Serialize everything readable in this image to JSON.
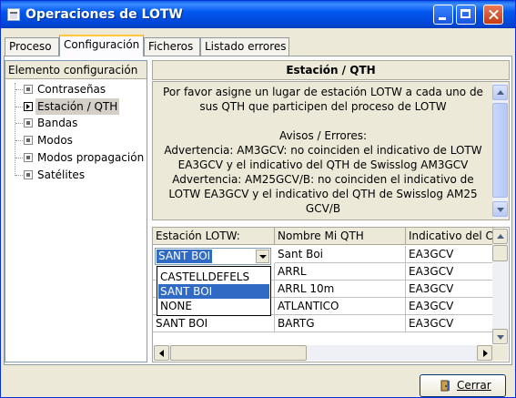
{
  "window": {
    "title": "Operaciones de LOTW"
  },
  "tabs": [
    "Proceso",
    "Configuración",
    "Ficheros",
    "Listado errores"
  ],
  "tree": {
    "header": "Elemento configuración",
    "items": [
      "Contraseñas",
      "Estación / QTH",
      "Bandas",
      "Modos",
      "Modos propagación",
      "Satélites"
    ],
    "selected": "Estación / QTH"
  },
  "section_title": "Estación / QTH",
  "message": {
    "lines": [
      "Por favor asigne un lugar de estación LOTW a cada uno de",
      "sus QTH que participen del proceso de LOTW",
      "",
      "Avisos / Errores:",
      "Advertencia: AM3GCV: no coinciden el indicativo de LOTW",
      "EA3GCV y el indicativo del QTH de Swisslog AM3GCV",
      "Advertencia: AM25GCV/B: no coinciden el indicativo de",
      "LOTW EA3GCV y el indicativo del QTH de Swisslog AM25",
      "GCV/B"
    ]
  },
  "grid": {
    "columns": [
      "Estación LOTW:",
      "Nombre Mi QTH",
      "Indicativo del C"
    ],
    "rows": [
      [
        "SANT BOI",
        "Sant Boi",
        "EA3GCV"
      ],
      [
        "",
        "ARRL",
        "EA3GCV"
      ],
      [
        "",
        "ARRL 10m",
        "EA3GCV"
      ],
      [
        "",
        "ATLANTICO",
        "EA3GCV"
      ],
      [
        "SANT BOI",
        "BARTG",
        "EA3GCV"
      ]
    ],
    "dropdown_options": [
      "CASTELLDEFELS",
      "SANT BOI",
      "NONE"
    ],
    "dropdown_selected": "SANT BOI"
  },
  "buttons": {
    "close": "Cerrar"
  },
  "colors": {
    "selection": "#316ac5",
    "titlebar": "#0054e3",
    "window_bg": "#ece9d8"
  }
}
